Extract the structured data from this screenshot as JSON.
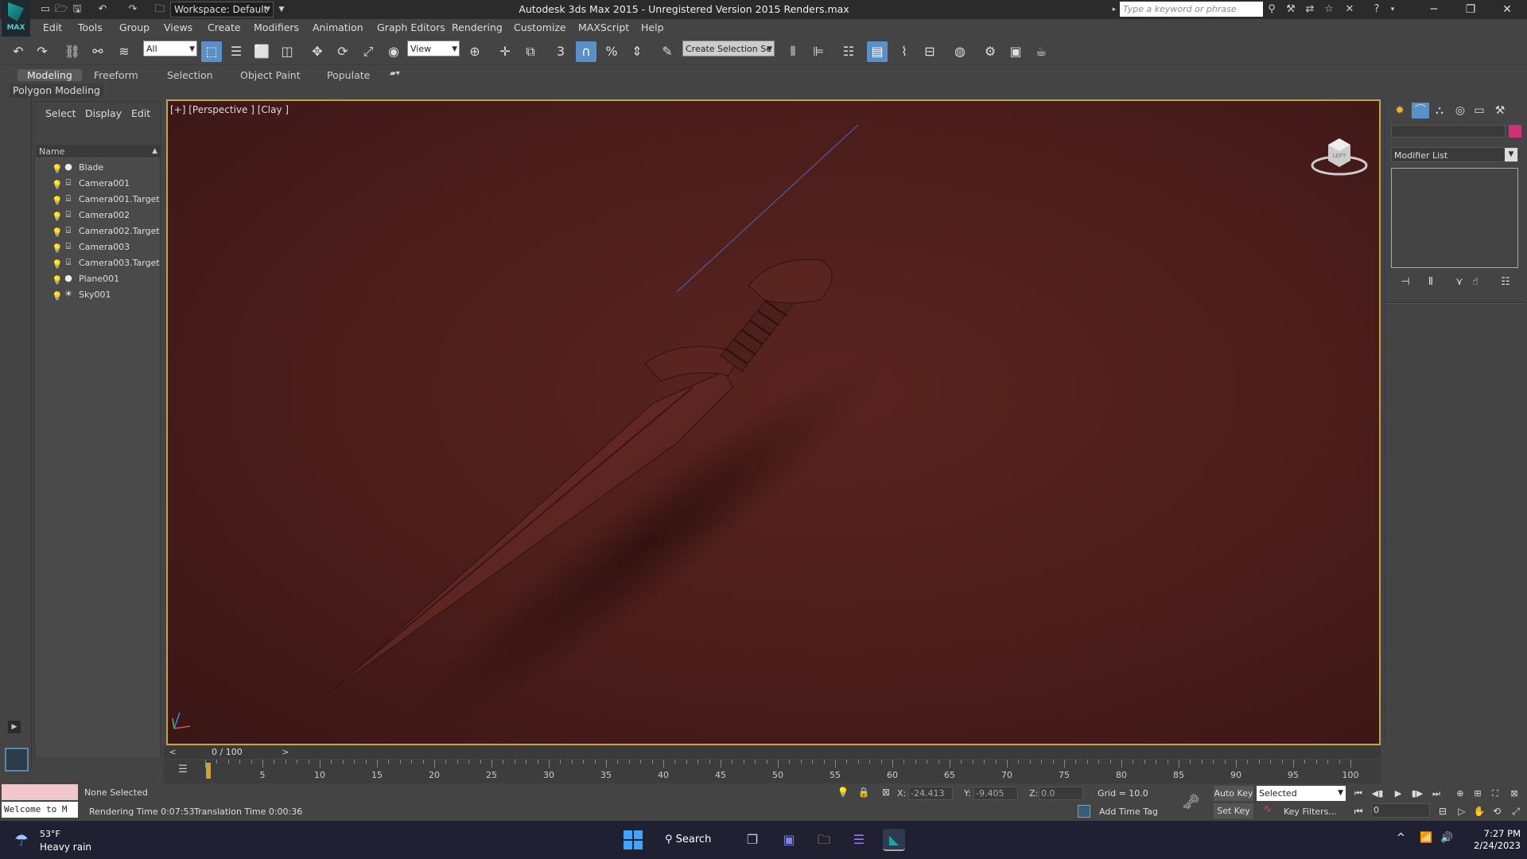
{
  "titlebar": {
    "workspace": "Workspace: Default",
    "app_title": "Autodesk 3ds Max  2015  - Unregistered Version   2015 Renders.max",
    "search_placeholder": "Type a keyword or phrase",
    "logo_text": "MAX",
    "quick_access_icons": [
      "new-file-icon",
      "open-file-icon",
      "save-icon",
      "undo-icon",
      "redo-icon",
      "project-folder-icon"
    ],
    "info_icons": [
      "binoculars-icon",
      "tools-icon",
      "exchange-icon",
      "star-icon",
      "close-x-icon",
      "help-icon"
    ],
    "window_buttons": {
      "minimize": "─",
      "maximize": "❐",
      "close": "✕"
    }
  },
  "menubar": {
    "items": [
      "Edit",
      "Tools",
      "Group",
      "Views",
      "Create",
      "Modifiers",
      "Animation",
      "Graph Editors",
      "Rendering",
      "Customize",
      "MAXScript",
      "Help"
    ]
  },
  "toolbar": {
    "selection_filter": "All",
    "reference_coord": "View",
    "named_selection": "Create Selection Se",
    "snap_label": "3",
    "active_tool": "select-object-icon"
  },
  "ribbon": {
    "tabs": [
      "Modeling",
      "Freeform",
      "Selection",
      "Object Paint",
      "Populate"
    ],
    "active_tab": "Modeling",
    "panel_label": "Polygon Modeling"
  },
  "scene_explorer": {
    "tabs": [
      "Select",
      "Display",
      "Edit"
    ],
    "column_header": "Name",
    "objects": [
      {
        "name": "Blade",
        "type": "geometry"
      },
      {
        "name": "Camera001",
        "type": "camera"
      },
      {
        "name": "Camera001.Target",
        "type": "camera"
      },
      {
        "name": "Camera002",
        "type": "camera"
      },
      {
        "name": "Camera002.Target",
        "type": "camera"
      },
      {
        "name": "Camera003",
        "type": "camera"
      },
      {
        "name": "Camera003.Target",
        "type": "camera"
      },
      {
        "name": "Plane001",
        "type": "geometry"
      },
      {
        "name": "Sky001",
        "type": "light"
      }
    ]
  },
  "viewport": {
    "label": "[+] [Perspective ] [Clay ]",
    "viewcube_face": "LEFT",
    "background_color": "#4a1d1b",
    "border_color": "#c8a240"
  },
  "command_panel": {
    "modifier_list": "Modifier List",
    "object_color": "#d0307a"
  },
  "timeline": {
    "current_frame": "0 / 100",
    "prev": "<",
    "next": ">",
    "start": 0,
    "end": 100,
    "tick_labels": [
      "5",
      "10",
      "15",
      "20",
      "25",
      "30",
      "35",
      "40",
      "45",
      "50",
      "55",
      "60",
      "65",
      "70",
      "75",
      "80",
      "85",
      "90",
      "95",
      "100"
    ]
  },
  "statusbar": {
    "selection_status": "None Selected",
    "rendering_time": "Rendering Time  0:07:53",
    "translation_time": "Translation Time  0:00:36",
    "listener_text": "Welcome to M",
    "x_label": "X:",
    "x_value": "-24.413",
    "y_label": "Y:",
    "y_value": "-9.405",
    "z_label": "Z:",
    "z_value": "0.0",
    "grid": "Grid = 10.0",
    "add_time_tag": "Add Time Tag",
    "auto_key": "Auto Key",
    "set_key": "Set Key",
    "key_mode": "Selected",
    "key_filters": "Key Filters...",
    "frame_field": "0"
  },
  "taskbar": {
    "temperature": "53°F",
    "weather": "Heavy rain",
    "search": "Search",
    "time": "7:27 PM",
    "date": "2/24/2023"
  }
}
